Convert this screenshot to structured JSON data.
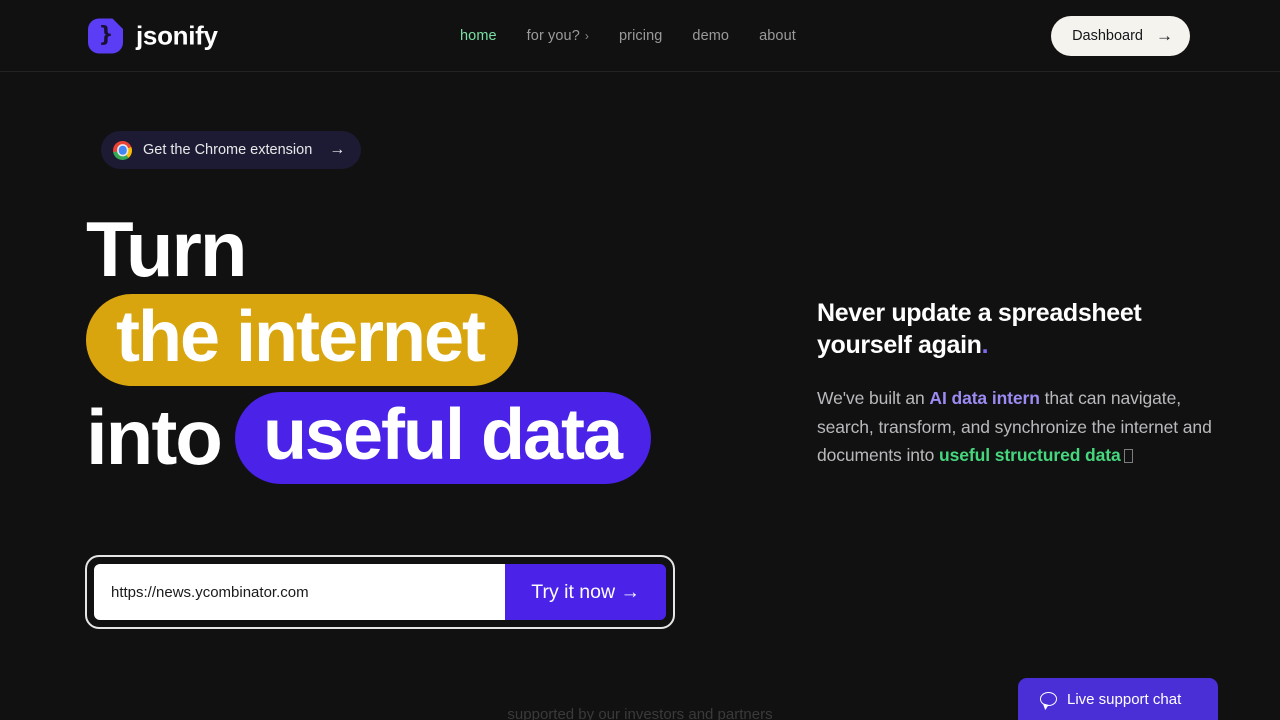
{
  "header": {
    "brand_name": "jsonify",
    "logo_glyph": "}",
    "nav": [
      {
        "label": "home",
        "active": true,
        "chevron": ""
      },
      {
        "label": "for you?",
        "active": false,
        "chevron": "›"
      },
      {
        "label": "pricing",
        "active": false,
        "chevron": ""
      },
      {
        "label": "demo",
        "active": false,
        "chevron": ""
      },
      {
        "label": "about",
        "active": false,
        "chevron": ""
      }
    ],
    "dashboard_label": "Dashboard",
    "dashboard_arrow": "→"
  },
  "promo": {
    "label": "Get the Chrome extension",
    "arrow": "→",
    "icon": "chrome-icon"
  },
  "hero": {
    "line1": "Turn",
    "line2_pill": "the internet",
    "line3_word": "into",
    "line3_pill": "useful data"
  },
  "right": {
    "subhead_main": "Never update a spreadsheet yourself again",
    "subhead_dot": ".",
    "body_part1": "We've built an ",
    "body_accent_purple": "AI data intern",
    "body_part2": " that can navigate, search, transform, and synchronize the internet and documents into ",
    "body_accent_green": "useful structured data"
  },
  "search": {
    "value": "https://news.ycombinator.com",
    "placeholder": "https://news.ycombinator.com",
    "button_label": "Try it now →"
  },
  "footer": {
    "supported_text": "supported by our investors and partners"
  },
  "chat": {
    "label": "Live support chat"
  },
  "colors": {
    "background": "#111111",
    "purple": "#4A22E8",
    "gold": "#D9A50F",
    "green": "#45D67E",
    "accent_lavender": "#9B8BF2",
    "nav_active": "#7AE0A4",
    "chat_purple": "#4A2FD6"
  }
}
